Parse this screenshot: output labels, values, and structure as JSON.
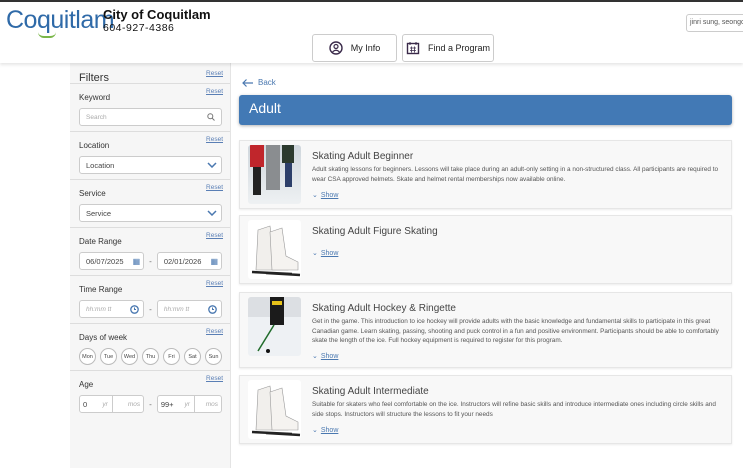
{
  "header": {
    "logo": "Coquitlam",
    "org_name": "City of Coquitlam",
    "phone": "604-927-4386",
    "user": "jinri sung, seongcoo",
    "nav": [
      {
        "label": "My Info",
        "icon": "user-circle-icon"
      },
      {
        "label": "Find a Program",
        "icon": "calendar-icon"
      }
    ]
  },
  "filters": {
    "title": "Filters",
    "reset": "Reset",
    "keyword": {
      "label": "Keyword",
      "placeholder": "Search"
    },
    "location": {
      "label": "Location",
      "value": "Location"
    },
    "service": {
      "label": "Service",
      "value": "Service"
    },
    "date_range": {
      "label": "Date Range",
      "start": "06/07/2025",
      "end": "02/01/2026"
    },
    "time_range": {
      "label": "Time Range",
      "start_placeholder": "hh:mm tt",
      "end_placeholder": "hh:mm tt"
    },
    "days": {
      "label": "Days of week",
      "items": [
        "Mon",
        "Tue",
        "Wed",
        "Thu",
        "Fri",
        "Sat",
        "Sun"
      ]
    },
    "age": {
      "label": "Age",
      "min_yr": "0",
      "max_yr": "99+",
      "yr_unit": "yr",
      "mos_unit": "mos"
    },
    "dash": "-"
  },
  "main": {
    "back": "Back",
    "category": "Adult",
    "show_label": "Show",
    "programs": [
      {
        "title": "Skating Adult Beginner",
        "description": "Adult skating lessons for beginners. Lessons will take place during an adult-only setting in a non-structured class. All participants are required to wear CSA approved helmets. Skate and helmet rental memberships now available online."
      },
      {
        "title": "Skating Adult Figure Skating",
        "description": ""
      },
      {
        "title": "Skating Adult Hockey & Ringette",
        "description": "Get in the game. This introduction to ice hockey will provide adults with the basic knowledge and fundamental skills to participate in this great Canadian game. Learn skating, passing, shooting and puck control in a fun and positive environment. Participants should be able to comfortably skate the length of the ice. Full hockey equipment is required to register for this program."
      },
      {
        "title": "Skating Adult Intermediate",
        "description": "Suitable for skaters who feel comfortable on the ice. Instructors will refine basic skills and introduce intermediate ones including circle skills and side stops. Instructors will structure the lessons to fit your needs"
      }
    ]
  },
  "colors": {
    "accent": "#4279b5",
    "link": "#4a78b0",
    "logo_green": "#7ab648"
  }
}
